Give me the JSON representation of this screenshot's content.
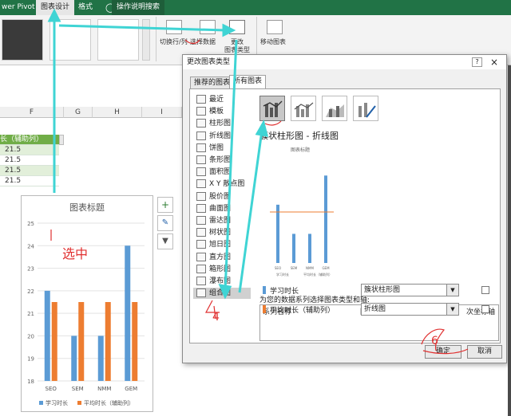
{
  "ribbon": {
    "tabs": [
      "wer Pivot",
      "图表设计",
      "格式"
    ],
    "help_label": "操作说明搜索",
    "switch_row_col": "切换行/列",
    "select_data": "选择数据",
    "change_type_line1": "更改",
    "change_type_line2": "图表类型",
    "move_chart": "移动图表"
  },
  "grid": {
    "columns": [
      "F",
      "G",
      "H",
      "I"
    ],
    "header_cell": "长（辅助列）",
    "values": [
      "21.5",
      "21.5",
      "21.5",
      "21.5",
      "21.5"
    ]
  },
  "chart": {
    "title": "图表标题",
    "annotation": "选中",
    "legend": [
      "学习时长",
      "平均时长（辅助列）"
    ],
    "colors": {
      "series1": "#5b9bd5",
      "series2": "#ed7d31"
    }
  },
  "chart_data": {
    "type": "bar",
    "title": "图表标题",
    "categories": [
      "SEO",
      "SEM",
      "NMM",
      "GEM"
    ],
    "series": [
      {
        "name": "学习时长",
        "values": [
          22,
          20,
          20,
          24
        ]
      },
      {
        "name": "平均时长（辅助列）",
        "values": [
          21.5,
          21.5,
          21.5,
          21.5
        ]
      }
    ],
    "ylim": [
      18,
      25
    ],
    "yticks": [
      "18",
      "19",
      "20",
      "21",
      "22",
      "23",
      "24",
      "25"
    ],
    "grid": true,
    "legend": "bottom"
  },
  "dialog": {
    "title": "更改图表类型",
    "tab_recommended": "推荐的图表",
    "tab_all": "所有图表",
    "categories": [
      "最近",
      "模板",
      "柱形图",
      "折线图",
      "饼图",
      "条形图",
      "面积图",
      "X Y 散点图",
      "股价图",
      "曲面图",
      "雷达图",
      "树状图",
      "旭日图",
      "直方图",
      "箱形图",
      "瀑布图",
      "组合图"
    ],
    "subtype_title": "簇状柱形图 - 折线图",
    "preview_title": "图表标题",
    "preview_legend": [
      "学习时长",
      "平均时长（辅助列）"
    ],
    "preview_categories": [
      "SEO",
      "SEM",
      "NMM",
      "GEM"
    ],
    "preview_values": [
      22,
      20,
      20,
      24
    ],
    "preview_avg": 21.5,
    "series_prompt": "为您的数据系列选择图表类型和轴:",
    "header_series": "系列名称",
    "header_type": "图表类型",
    "header_axis": "次坐标轴",
    "rows": [
      {
        "name": "学习时长",
        "type": "簇状柱形图"
      },
      {
        "name": "平均时长（辅助列）",
        "type": "折线图"
      }
    ],
    "ok_label": "确定",
    "cancel_label": "取消",
    "help_icon": "?",
    "close_icon": "×"
  },
  "annotations": {
    "num4": "4",
    "num6": "6"
  }
}
